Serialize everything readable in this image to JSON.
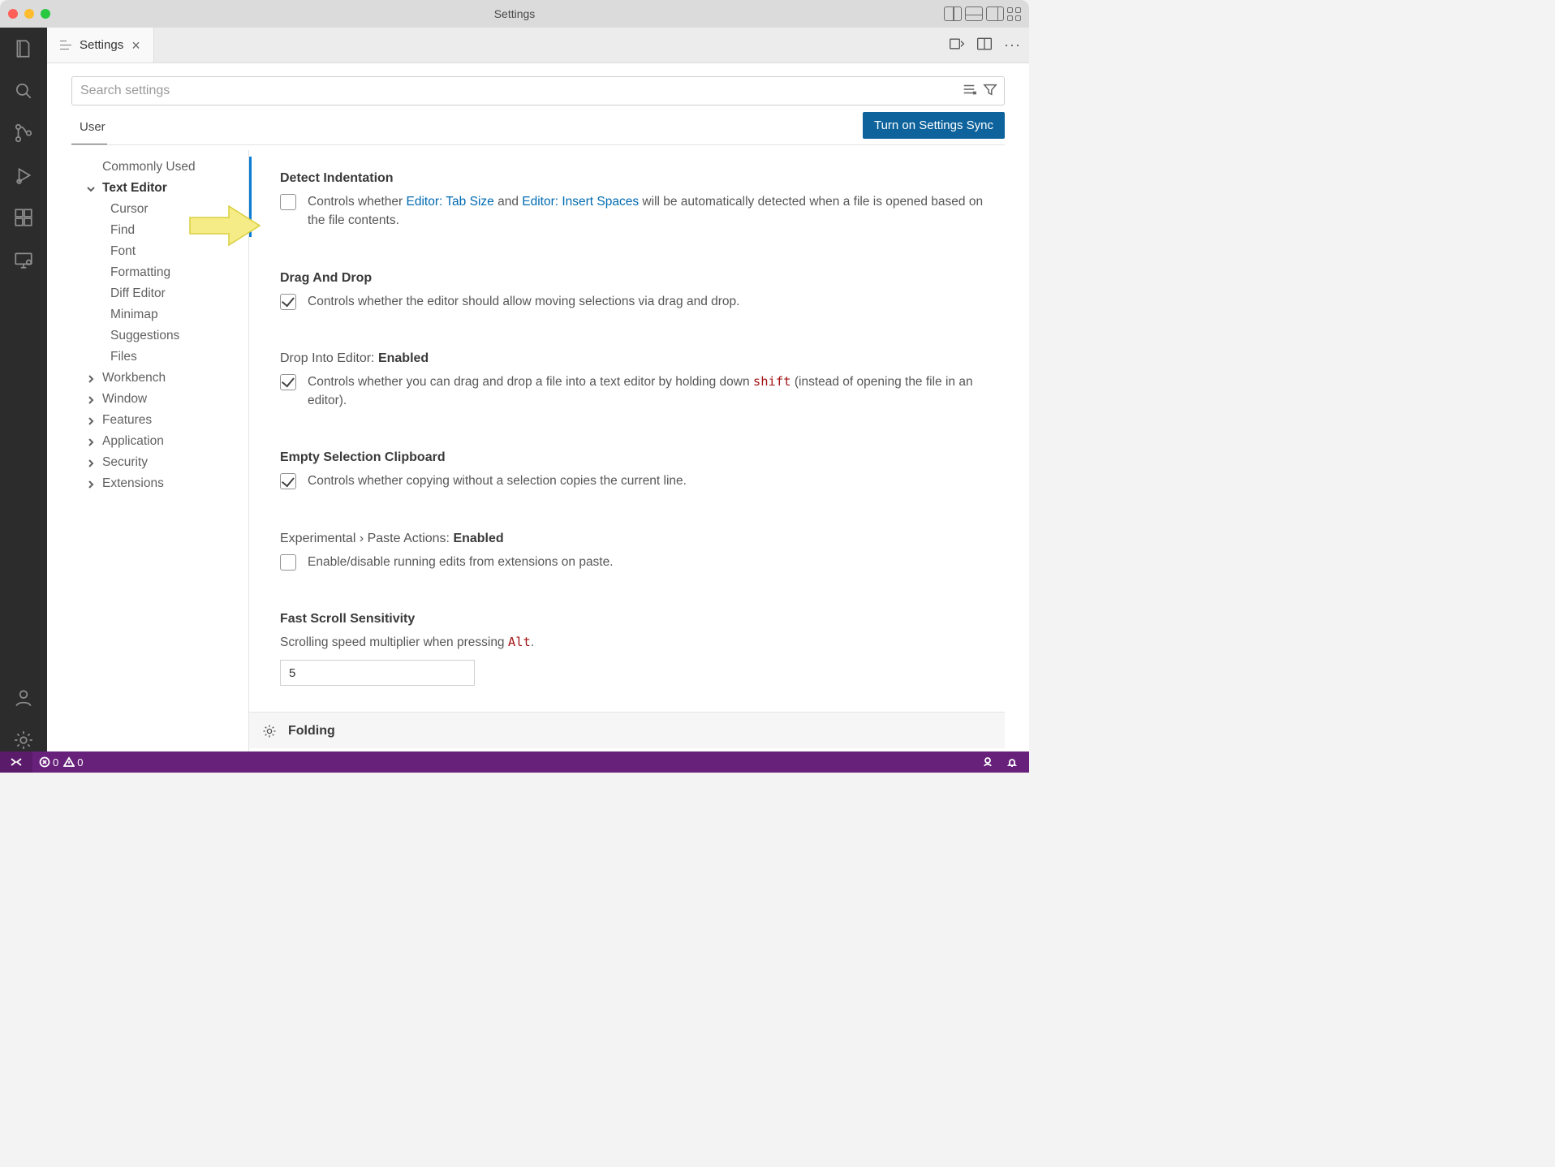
{
  "titlebar": {
    "title": "Settings"
  },
  "tab": {
    "label": "Settings"
  },
  "search": {
    "placeholder": "Search settings"
  },
  "scope": {
    "tab": "User"
  },
  "sync_button": "Turn on Settings Sync",
  "tree": {
    "commonly_used": "Commonly Used",
    "text_editor": "Text Editor",
    "cursor": "Cursor",
    "find": "Find",
    "font": "Font",
    "formatting": "Formatting",
    "diff_editor": "Diff Editor",
    "minimap": "Minimap",
    "suggestions": "Suggestions",
    "files": "Files",
    "workbench": "Workbench",
    "window": "Window",
    "features": "Features",
    "application": "Application",
    "security": "Security",
    "extensions": "Extensions"
  },
  "settings": {
    "detect_indentation": {
      "title": "Detect Indentation",
      "desc_pre": "Controls whether ",
      "link1": "Editor: Tab Size",
      "mid": " and ",
      "link2": "Editor: Insert Spaces",
      "desc_post": " will be automatically detected when a file is opened based on the file contents."
    },
    "drag_and_drop": {
      "title": "Drag And Drop",
      "desc": "Controls whether the editor should allow moving selections via drag and drop."
    },
    "drop_into_editor": {
      "title_pre": "Drop Into Editor: ",
      "title_suffix": "Enabled",
      "desc_pre": "Controls whether you can drag and drop a file into a text editor by holding down ",
      "kw": "shift",
      "desc_post": " (instead of opening the file in an editor)."
    },
    "empty_selection": {
      "title": "Empty Selection Clipboard",
      "desc": "Controls whether copying without a selection copies the current line."
    },
    "paste_actions": {
      "title_pre": "Experimental › Paste Actions: ",
      "title_suffix": "Enabled",
      "desc": "Enable/disable running edits from extensions on paste."
    },
    "fast_scroll": {
      "title": "Fast Scroll Sensitivity",
      "desc_pre": "Scrolling speed multiplier when pressing ",
      "kw": "Alt",
      "desc_post": ".",
      "value": "5"
    },
    "folding": {
      "title": "Folding"
    }
  },
  "statusbar": {
    "errors": "0",
    "warnings": "0"
  }
}
